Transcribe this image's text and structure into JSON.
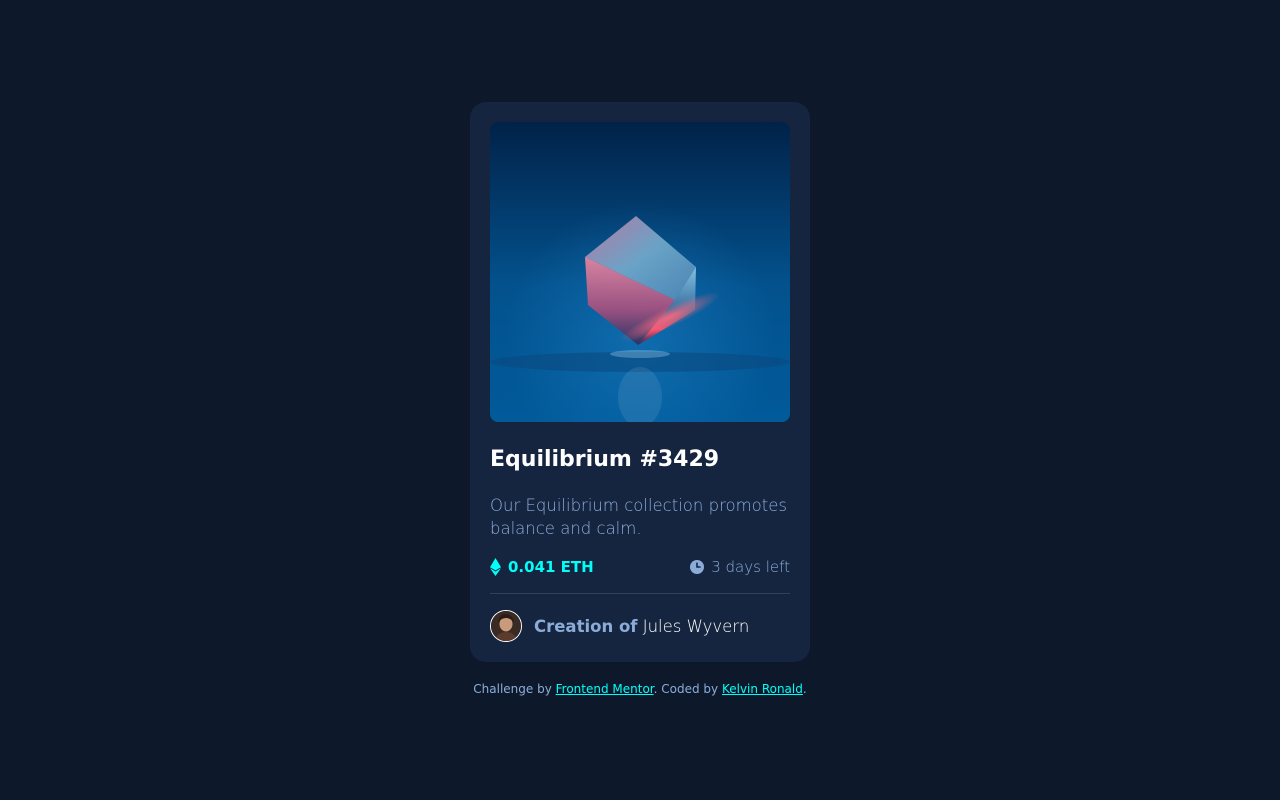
{
  "card": {
    "image_alt": "Equilibrium crystal cube",
    "title": "Equilibrium #3429",
    "description": "Our Equilibrium collection promotes balance and calm.",
    "price": "0.041 ETH",
    "time_left": "3 days left",
    "creator_prefix": "Creation of",
    "creator_name": "Jules Wyvern",
    "icons": {
      "price": "ethereum-icon",
      "time": "clock-icon"
    }
  },
  "attribution": {
    "prefix": "Challenge by",
    "challenge_link": "Frontend Mentor",
    "middle": ". Coded by",
    "author_link": "Kelvin Ronald",
    "suffix": "."
  },
  "colors": {
    "page_bg": "#0d192b",
    "card_bg": "#15253f",
    "accent_cyan": "#00fff8",
    "soft_blue": "#8bacd9",
    "white": "#ffffff",
    "divider": "#2e405a"
  }
}
